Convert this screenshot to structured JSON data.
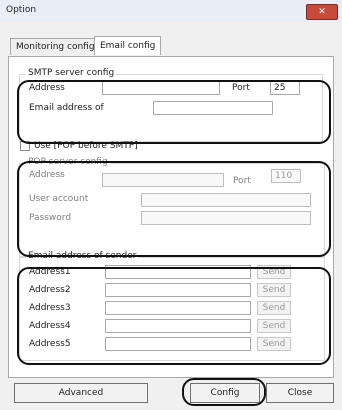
{
  "window": {
    "title": "Option",
    "close_glyph": "✕"
  },
  "tabs": [
    {
      "label": "Monitoring config",
      "active": false
    },
    {
      "label": "Email config",
      "active": true
    }
  ],
  "smtp": {
    "group_label": "SMTP server config",
    "address_label": "Address",
    "address_value": "",
    "port_label": "Port",
    "port_value": "25",
    "email_label": "Email address of",
    "email_value": ""
  },
  "pop": {
    "use_label": "Use [POP before SMTP]",
    "use_checked": false,
    "group_label": "POP server config",
    "address_label": "Address",
    "address_value": "",
    "port_label": "Port",
    "port_value": "110",
    "user_label": "User account",
    "user_value": "",
    "password_label": "Password",
    "password_value": ""
  },
  "sender": {
    "group_label": "Email address of sender",
    "rows": [
      {
        "label": "Address1",
        "value": "",
        "button": "Send"
      },
      {
        "label": "Address2",
        "value": "",
        "button": "Send"
      },
      {
        "label": "Address3",
        "value": "",
        "button": "Send"
      },
      {
        "label": "Address4",
        "value": "",
        "button": "Send"
      },
      {
        "label": "Address5",
        "value": "",
        "button": "Send"
      }
    ]
  },
  "footer": {
    "advanced_label": "Advanced",
    "config_label": "Config",
    "close_label": "Close"
  },
  "colors": {
    "titlebar": "#e9eef6",
    "close_button": "#c74a3b",
    "callout": "#111111",
    "disabled_text": "#808080"
  }
}
